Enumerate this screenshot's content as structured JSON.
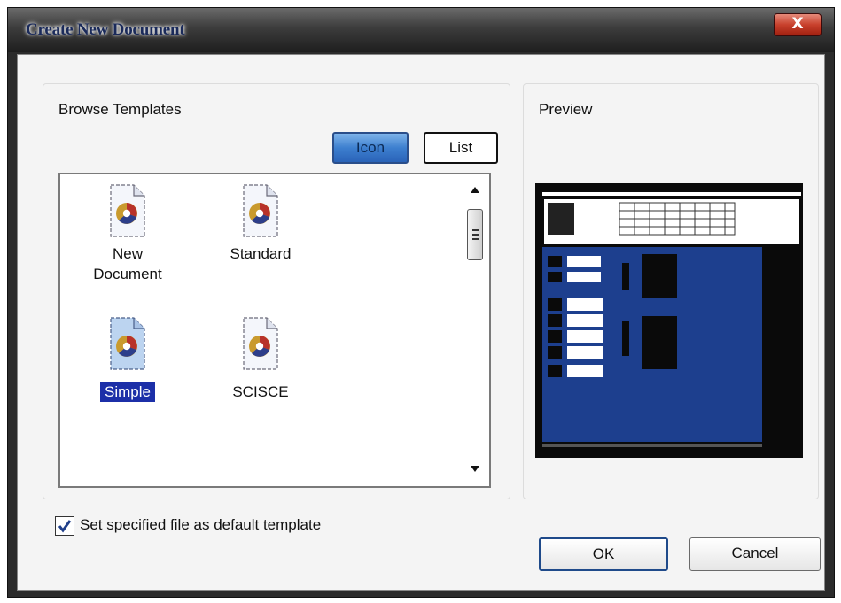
{
  "dialog": {
    "title": "Create New Document",
    "close_label": "X"
  },
  "browse": {
    "label": "Browse Templates",
    "view_icon_label": "Icon",
    "view_list_label": "List",
    "items": [
      {
        "line1": "New",
        "line2": "Document",
        "selected": false
      },
      {
        "line1": "Standard",
        "line2": "",
        "selected": false
      },
      {
        "line1": "Simple",
        "line2": "",
        "selected": true
      },
      {
        "line1": "SCISCE",
        "line2": "",
        "selected": false
      }
    ]
  },
  "preview": {
    "label": "Preview"
  },
  "default_checkbox": {
    "label": "Set specified file as default template",
    "checked": true
  },
  "buttons": {
    "ok": "OK",
    "cancel": "Cancel"
  },
  "colors": {
    "selection": "#1c2fa8",
    "preview_blue": "#1d3f8e",
    "close_red": "#c8402c"
  }
}
